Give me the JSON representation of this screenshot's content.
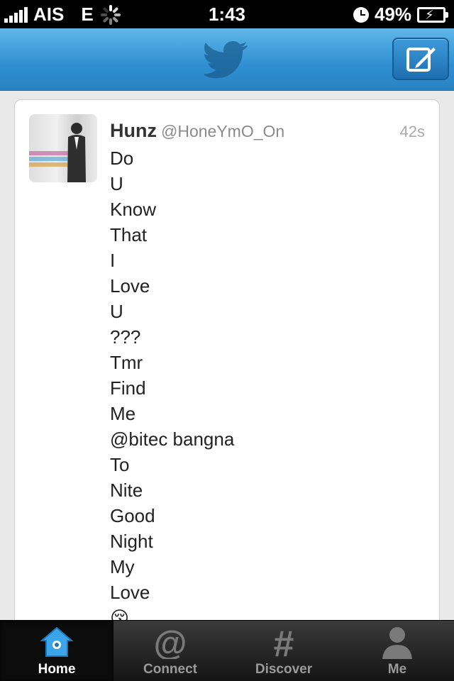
{
  "status_bar": {
    "carrier": "AIS",
    "network": "E",
    "time": "1:43",
    "battery": "49%"
  },
  "nav": {
    "logo_icon": "twitter-bird-icon",
    "compose_icon": "compose-icon"
  },
  "tweet": {
    "display_name": "Hunz",
    "handle": "@HoneYmO_On",
    "timestamp": "42s",
    "lines": [
      "Do",
      "U",
      "Know",
      "That",
      "I",
      "Love",
      "U",
      "???",
      "Tmr",
      "Find",
      "Me",
      "@bitec bangna",
      "To",
      "Nite",
      "Good",
      "Night",
      "My",
      "Love",
      "😚"
    ]
  },
  "tabs": [
    {
      "label": "Home",
      "icon": "home-icon",
      "active": true
    },
    {
      "label": "Connect",
      "icon": "at-icon",
      "active": false
    },
    {
      "label": "Discover",
      "icon": "hash-icon",
      "active": false
    },
    {
      "label": "Me",
      "icon": "person-icon",
      "active": false
    }
  ],
  "colors": {
    "nav_blue": "#2f8fd0",
    "home_icon_blue": "#3aa5e8"
  }
}
